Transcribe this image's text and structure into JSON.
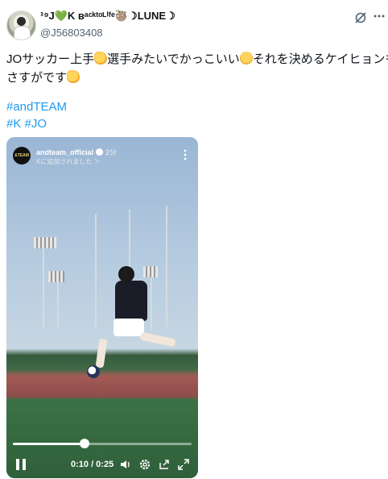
{
  "header": {
    "display_name": "¹⁹J💚K ʙᵃᶜᵏᵗᵒᴸⁱᶠᵉ🦥☽LUNE☽",
    "handle": "@J56803408",
    "grok_icon": "grok-icon",
    "more_icon": "more-icon"
  },
  "tweet": {
    "line1_a": "JOサッカー上手",
    "line1_b": "選手みたいでかっこいい",
    "line1_c": "それを決めるケイヒョンも",
    "line2_a": "さすがです",
    "hashtags_line1": "#andTEAM",
    "hashtags_line2_a": "#K",
    "hashtags_line2_b": "#JO",
    "emoji_clap": "clapping-hands-emoji",
    "emoji_smile": "relieved-face-emoji"
  },
  "video": {
    "account_avatar_text": "&TEAM",
    "account_name": "andteam_official",
    "time_ago": "2分",
    "subtitle": "Kに追加されました ＞",
    "time_display": "0:10 / 0:25",
    "progress": 0.4,
    "colors": {
      "progress": "#ffffff",
      "link": "#1d9bf0"
    }
  }
}
